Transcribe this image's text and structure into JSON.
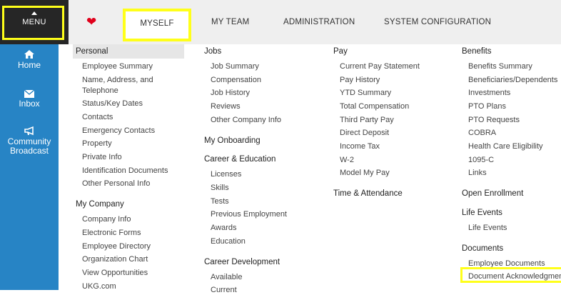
{
  "topnav": {
    "menu_label": "MENU",
    "tabs": [
      "MYSELF",
      "MY TEAM",
      "ADMINISTRATION",
      "SYSTEM CONFIGURATION"
    ]
  },
  "sidebar": {
    "items": [
      {
        "label": "Home"
      },
      {
        "label": "Inbox"
      },
      {
        "label_line1": "Community",
        "label_line2": "Broadcast"
      }
    ]
  },
  "col1": {
    "personal_title": "Personal",
    "personal_links": [
      "Employee Summary",
      "Name, Address, and",
      "Telephone",
      "Status/Key Dates",
      "Contacts",
      "Emergency Contacts",
      "Property",
      "Private Info",
      "Identification Documents",
      "Other Personal Info"
    ],
    "company_title": "My Company",
    "company_links": [
      "Company Info",
      "Electronic Forms",
      "Employee Directory",
      "Organization Chart",
      "View Opportunities",
      "UKG.com"
    ]
  },
  "col2": {
    "jobs_title": "Jobs",
    "jobs_links": [
      "Job Summary",
      "Compensation",
      "Job History",
      "Reviews",
      "Other Company Info"
    ],
    "onboarding_title": "My Onboarding",
    "career_title": "Career & Education",
    "career_links": [
      "Licenses",
      "Skills",
      "Tests",
      "Previous Employment",
      "Awards",
      "Education"
    ],
    "dev_title": "Career Development",
    "dev_links": [
      "Available",
      "Current"
    ]
  },
  "col3": {
    "pay_title": "Pay",
    "pay_links": [
      "Current Pay Statement",
      "Pay History",
      "YTD Summary",
      "Total Compensation",
      "Third Party Pay",
      "Direct Deposit",
      "Income Tax",
      "W-2",
      "Model My Pay"
    ],
    "time_title": "Time & Attendance"
  },
  "col4": {
    "benefits_title": "Benefits",
    "benefits_links": [
      "Benefits Summary",
      "Beneficiaries/Dependents",
      "Investments",
      "PTO Plans",
      "PTO Requests",
      "COBRA",
      "Health Care Eligibility",
      "1095-C",
      "Links"
    ],
    "enroll_title": "Open Enrollment",
    "life_title": "Life Events",
    "life_links": [
      "Life Events"
    ],
    "docs_title": "Documents",
    "docs_links": [
      "Employee Documents",
      "Document Acknowledgments"
    ]
  },
  "colors": {
    "sidebar": "#2784c5",
    "highlight": "#ffff1a",
    "heart": "#e0001b",
    "menu_bg": "#262626"
  }
}
